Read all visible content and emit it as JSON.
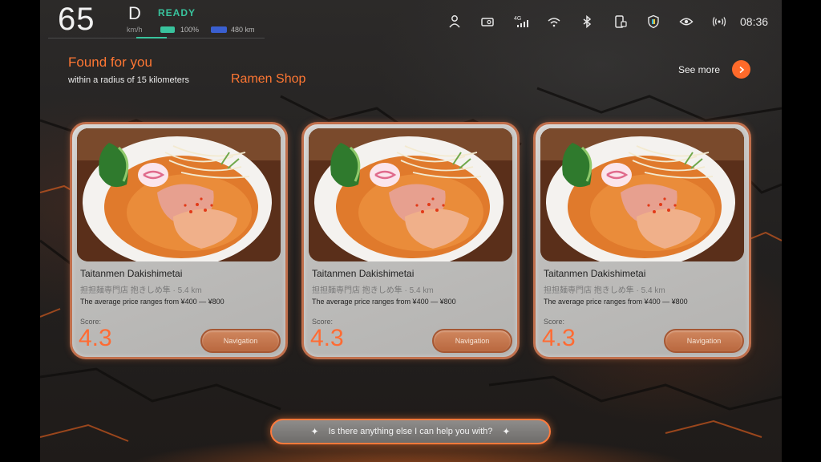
{
  "status_bar": {
    "speed": "65",
    "speed_unit": "km/h",
    "gear": "D",
    "ready": "READY",
    "battery": "100%",
    "range": "480 km",
    "icons": [
      "person-icon",
      "camera-icon",
      "signal-4g-icon",
      "wifi-icon",
      "bluetooth-icon",
      "phone-link-icon",
      "shield-icon",
      "eye-icon",
      "broadcast-icon"
    ],
    "signal_label": "4G",
    "time": "08:36"
  },
  "header": {
    "title": "Found for you",
    "subtitle": "within a radius of 15 kilometers",
    "category": "Ramen Shop",
    "see_more": "See more"
  },
  "results": [
    {
      "name": "Taitanmen Dakishimetai",
      "sub": "担担麺専門店 抱きしめ隼 · 5.4 km",
      "price": "The average price ranges from ¥400 — ¥800",
      "score_label": "Score:",
      "score": "4.3",
      "button": "Navigation"
    },
    {
      "name": "Taitanmen Dakishimetai",
      "sub": "担担麺専門店 抱きしめ隼 · 5.4 km",
      "price": "The average price ranges from ¥400 — ¥800",
      "score_label": "Score:",
      "score": "4.3",
      "button": "Navigation"
    },
    {
      "name": "Taitanmen Dakishimetai",
      "sub": "担担麺専門店 抱きしめ隼 · 5.4 km",
      "price": "The average price ranges from ¥400 — ¥800",
      "score_label": "Score:",
      "score": "4.3",
      "button": "Navigation"
    }
  ],
  "assistant": {
    "prompt": "Is there anything else I can help you with?"
  },
  "colors": {
    "accent": "#ff7733",
    "ready": "#39c39d",
    "card_border": "#c06f4c",
    "nav_button": "#b9683f"
  }
}
